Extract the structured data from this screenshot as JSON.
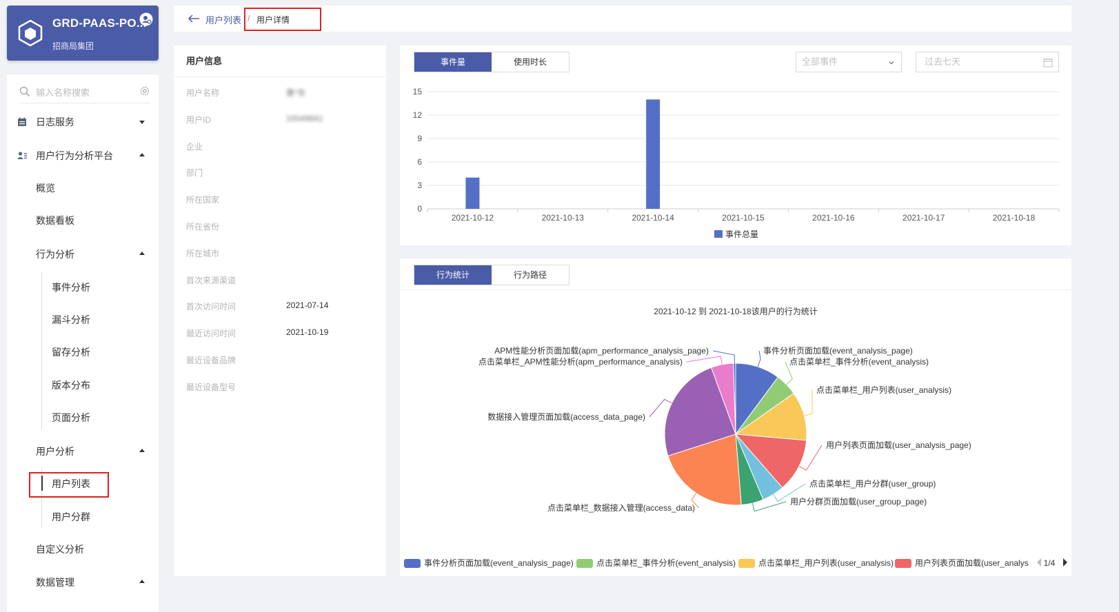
{
  "org": {
    "name": "GRD-PAAS-PO...",
    "subtitle": "招商局集团"
  },
  "sidebar": {
    "search_placeholder": "输入名称搜索",
    "items": [
      {
        "label": "日志服务"
      },
      {
        "label": "用户行为分析平台"
      },
      {
        "label": "概览"
      },
      {
        "label": "数据看板"
      },
      {
        "label": "行为分析"
      },
      {
        "label": "事件分析"
      },
      {
        "label": "漏斗分析"
      },
      {
        "label": "留存分析"
      },
      {
        "label": "版本分布"
      },
      {
        "label": "页面分析"
      },
      {
        "label": "用户分析"
      },
      {
        "label": "用户列表"
      },
      {
        "label": "用户分群"
      },
      {
        "label": "自定义分析"
      },
      {
        "label": "数据管理"
      }
    ]
  },
  "breadcrumb": {
    "parent": "用户列表",
    "separator": "/",
    "current": "用户详情"
  },
  "user_info": {
    "title": "用户信息",
    "fields": [
      {
        "key": "用户名称",
        "value": "黄*东"
      },
      {
        "key": "用户ID",
        "value": "10049841"
      },
      {
        "key": "企业",
        "value": ""
      },
      {
        "key": "部门",
        "value": ""
      },
      {
        "key": "所在国家",
        "value": ""
      },
      {
        "key": "所在省份",
        "value": ""
      },
      {
        "key": "所在城市",
        "value": ""
      },
      {
        "key": "首次来源渠道",
        "value": ""
      },
      {
        "key": "首次访问时间",
        "value": "2021-07-14"
      },
      {
        "key": "最近访问时间",
        "value": "2021-10-19"
      },
      {
        "key": "最近设备品牌",
        "value": ""
      },
      {
        "key": "最近设备型号",
        "value": ""
      }
    ]
  },
  "event_panel": {
    "tabs": [
      {
        "label": "事件量"
      },
      {
        "label": "使用时长"
      }
    ],
    "event_select": "全部事件",
    "date_range": "过去七天"
  },
  "behavior_panel": {
    "tabs": [
      {
        "label": "行为统计"
      },
      {
        "label": "行为路径"
      }
    ],
    "pager": "1/4"
  },
  "colors": {
    "accent": "#4a5ba8",
    "bar": "#5470c6",
    "highlight": "#e02020"
  },
  "chart_data": [
    {
      "type": "bar",
      "categories": [
        "2021-10-12",
        "2021-10-13",
        "2021-10-14",
        "2021-10-15",
        "2021-10-16",
        "2021-10-17",
        "2021-10-18"
      ],
      "series": [
        {
          "name": "事件总量",
          "values": [
            4,
            0,
            14,
            0,
            0,
            0,
            0
          ],
          "color": "#5470c6"
        }
      ],
      "yticks": [
        0,
        3,
        6,
        9,
        12,
        15
      ],
      "ylim": [
        0,
        15
      ],
      "legend": "bottom-center",
      "grid": true
    },
    {
      "type": "pie",
      "title": "2021-10-12 到 2021-10-18该用户的行为统计",
      "slices": [
        {
          "label": "事件分析页面加载(event_analysis_page)",
          "value": 10,
          "color": "#5470c6"
        },
        {
          "label": "点击菜单栏_事件分析(event_analysis)",
          "value": 5,
          "color": "#91cc75"
        },
        {
          "label": "点击菜单栏_用户列表(user_analysis)",
          "value": 11,
          "color": "#fac858"
        },
        {
          "label": "用户列表页面加载(user_analysis_page)",
          "value": 12,
          "color": "#ee6666"
        },
        {
          "label": "点击菜单栏_用户分群(user_group)",
          "value": 5,
          "color": "#73c0de"
        },
        {
          "label": "用户分群页面加载(user_group_page)",
          "value": 5,
          "color": "#3ba272"
        },
        {
          "label": "点击菜单栏_数据接入管理(access_data)",
          "value": 21,
          "color": "#fc8452"
        },
        {
          "label": "数据接入管理页面加载(access_data_page)",
          "value": 24,
          "color": "#9a60b4"
        },
        {
          "label": "点击菜单栏_APM性能分析(apm_performance_analysis)",
          "value": 5,
          "color": "#ea7ccc"
        },
        {
          "label": "APM性能分析页面加载(apm_performance_analysis_page)",
          "value": 0.5,
          "color": "#5470c6"
        }
      ],
      "legend_visible": [
        {
          "label": "事件分析页面加载(event_analysis_page)",
          "color": "#5470c6"
        },
        {
          "label": "点击菜单栏_事件分析(event_analysis)",
          "color": "#91cc75"
        },
        {
          "label": "点击菜单栏_用户列表(user_analysis)",
          "color": "#fac858"
        },
        {
          "label": "用户列表页面加载(user_analys",
          "color": "#ee6666"
        }
      ]
    }
  ]
}
